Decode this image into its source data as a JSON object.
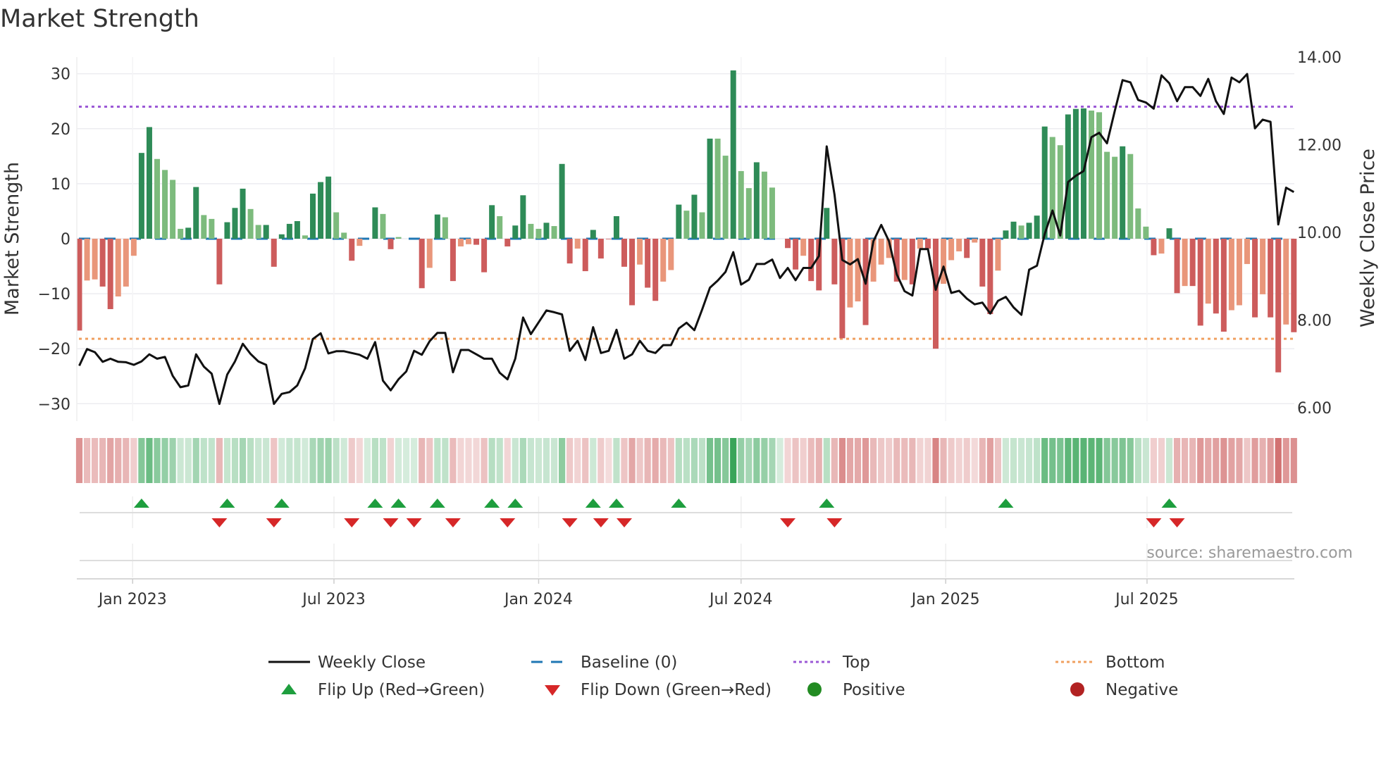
{
  "title": "Market Strength",
  "source": "source: sharemaestro.com",
  "colors": {
    "strong_green": "#2e8b57",
    "weak_green": "#7dbb7d",
    "strong_red": "#cd5c5c",
    "weak_red": "#e9967a",
    "line": "#111111",
    "baseline": "#1f77b4",
    "top": "#9b59d6",
    "bottom": "#f0a060",
    "flip_up": "#1e9e3e",
    "flip_down": "#d62728",
    "positive": "#228b22",
    "negative": "#b22222"
  },
  "chart_data": {
    "type": "bar",
    "title": "Market Strength",
    "ylabel": "Market Strength",
    "y2label": "Weekly Close Price",
    "ylim": [
      -33,
      33
    ],
    "y2lim": [
      5.4,
      14.6
    ],
    "yticks": [
      "30",
      "20",
      "10",
      "0",
      "−10",
      "−20",
      "−30"
    ],
    "ytick_values": [
      30,
      20,
      10,
      0,
      -10,
      -20,
      -30
    ],
    "y2ticks": [
      "14.00",
      "12.00",
      "10.00",
      "8.00",
      "6.00"
    ],
    "y2tick_values": [
      14,
      12,
      10,
      8,
      6
    ],
    "xticks": [
      {
        "label": "Jan 2023",
        "date": "2023-01-01"
      },
      {
        "label": "Jul 2023",
        "date": "2023-07-01"
      },
      {
        "label": "Jan 2024",
        "date": "2024-01-01"
      },
      {
        "label": "Jul 2024",
        "date": "2024-07-01"
      },
      {
        "label": "Jan 2025",
        "date": "2025-01-01"
      },
      {
        "label": "Jul 2025",
        "date": "2025-07-01"
      }
    ],
    "x_start": "2022-11-14",
    "x_step_days": 7,
    "top_level": 24,
    "bottom_level": -18.2,
    "baseline": 0,
    "strength": [
      -16.7,
      -7.6,
      -7.4,
      -8.7,
      -12.8,
      -10.5,
      -8.7,
      -3.1,
      15.6,
      20.3,
      14.5,
      12.5,
      10.7,
      1.8,
      2.0,
      9.4,
      4.3,
      3.6,
      -8.3,
      3.0,
      5.6,
      9.1,
      5.4,
      2.5,
      2.5,
      -5.1,
      0.8,
      2.7,
      3.2,
      0.6,
      8.2,
      10.3,
      11.3,
      4.8,
      1.1,
      -4.0,
      -1.3,
      0,
      5.7,
      4.5,
      -1.9,
      0.3,
      0,
      0,
      -9.0,
      -5.3,
      4.4,
      3.9,
      -7.7,
      -1.4,
      -1.0,
      -1.1,
      -6.1,
      6.1,
      4.1,
      -1.4,
      2.4,
      7.9,
      2.7,
      1.8,
      2.9,
      2.3,
      13.6,
      -4.5,
      -1.8,
      -5.9,
      1.6,
      -3.6,
      -0.1,
      4.1,
      -5.1,
      -12.1,
      -4.7,
      -8.9,
      -11.3,
      -7.8,
      -5.7,
      6.2,
      5.1,
      8.0,
      4.8,
      18.2,
      18.2,
      15.1,
      30.6,
      12.3,
      9.2,
      13.9,
      12.2,
      9.3,
      0,
      -1.7,
      -5.6,
      -3.1,
      -7.7,
      -9.4,
      5.6,
      -8.3,
      -18.1,
      -12.5,
      -11.4,
      -15.7,
      -7.8,
      -4.7,
      -3.5,
      -7.8,
      -7.5,
      -8.3,
      -1.8,
      -1.8,
      -20.0,
      -8.2,
      -3.9,
      -2.3,
      -3.5,
      -0.7,
      -8.7,
      -13.7,
      -5.8,
      1.5,
      3.1,
      2.4,
      2.9,
      4.2,
      20.4,
      18.5,
      17.0,
      22.6,
      23.6,
      23.7,
      23.3,
      23.0,
      15.8,
      14.9,
      16.8,
      15.4,
      5.5,
      2.2,
      -3.0,
      -2.7,
      1.9,
      -9.9,
      -8.6,
      -8.6,
      -15.8,
      -11.8,
      -13.6,
      -16.9,
      -13.0,
      -12.1,
      -4.6,
      -14.3,
      -10.1,
      -14.3,
      -24.3,
      -15.6,
      -17.0
    ],
    "shade": [
      "R",
      "o",
      "o",
      "R",
      "R",
      "o",
      "o",
      "o",
      "G",
      "G",
      "g",
      "g",
      "g",
      "g",
      "G",
      "G",
      "g",
      "g",
      "R",
      "G",
      "G",
      "G",
      "g",
      "g",
      "G",
      "R",
      "G",
      "G",
      "G",
      "g",
      "G",
      "G",
      "G",
      "g",
      "g",
      "R",
      "o",
      "o",
      "G",
      "g",
      "R",
      "g",
      "R",
      "R",
      "R",
      "o",
      "G",
      "g",
      "R",
      "o",
      "o",
      "R",
      "R",
      "G",
      "g",
      "R",
      "G",
      "G",
      "g",
      "g",
      "G",
      "g",
      "G",
      "R",
      "o",
      "R",
      "G",
      "R",
      "R",
      "G",
      "R",
      "R",
      "o",
      "R",
      "R",
      "o",
      "o",
      "G",
      "g",
      "G",
      "g",
      "G",
      "g",
      "g",
      "G",
      "g",
      "g",
      "G",
      "g",
      "g",
      "g",
      "R",
      "R",
      "o",
      "R",
      "R",
      "G",
      "R",
      "R",
      "o",
      "o",
      "R",
      "o",
      "o",
      "o",
      "R",
      "o",
      "R",
      "o",
      "R",
      "R",
      "o",
      "o",
      "o",
      "R",
      "o",
      "R",
      "R",
      "o",
      "G",
      "G",
      "g",
      "G",
      "G",
      "G",
      "g",
      "g",
      "G",
      "G",
      "G",
      "g",
      "g",
      "g",
      "g",
      "G",
      "g",
      "g",
      "g",
      "R",
      "o",
      "G",
      "R",
      "o",
      "R",
      "R",
      "o",
      "R",
      "R",
      "o",
      "o",
      "o",
      "R",
      "o",
      "R",
      "R",
      "o",
      "R"
    ],
    "weekly_close": [
      6.96,
      7.34,
      7.27,
      7.05,
      7.12,
      7.05,
      7.04,
      6.98,
      7.06,
      7.22,
      7.12,
      7.16,
      6.73,
      6.47,
      6.51,
      7.22,
      6.94,
      6.78,
      6.09,
      6.76,
      7.06,
      7.46,
      7.23,
      7.06,
      6.98,
      6.09,
      6.32,
      6.36,
      6.51,
      6.9,
      7.57,
      7.7,
      7.24,
      7.29,
      7.29,
      7.25,
      7.21,
      7.12,
      7.5,
      6.62,
      6.4,
      6.65,
      6.83,
      7.3,
      7.21,
      7.52,
      7.71,
      7.71,
      6.81,
      7.32,
      7.32,
      7.22,
      7.12,
      7.12,
      6.8,
      6.65,
      7.12,
      8.06,
      7.68,
      7.95,
      8.22,
      8.18,
      8.13,
      7.3,
      7.53,
      7.09,
      7.84,
      7.25,
      7.3,
      7.78,
      7.12,
      7.22,
      7.53,
      7.3,
      7.25,
      7.43,
      7.43,
      7.81,
      7.94,
      7.77,
      8.24,
      8.74,
      8.9,
      9.1,
      9.55,
      8.81,
      8.92,
      9.28,
      9.28,
      9.38,
      8.96,
      9.19,
      8.91,
      9.19,
      9.19,
      9.46,
      11.96,
      10.86,
      9.37,
      9.27,
      9.39,
      8.83,
      9.8,
      10.17,
      9.8,
      9.04,
      8.66,
      8.56,
      9.62,
      9.62,
      8.69,
      9.22,
      8.62,
      8.67,
      8.49,
      8.36,
      8.4,
      8.15,
      8.44,
      8.53,
      8.29,
      8.12,
      9.15,
      9.24,
      9.96,
      10.5,
      9.93,
      11.15,
      11.29,
      11.4,
      12.17,
      12.27,
      12.03,
      12.77,
      13.47,
      13.42,
      13.02,
      12.96,
      12.82,
      13.58,
      13.4,
      12.99,
      13.31,
      13.31,
      13.11,
      13.5,
      12.99,
      12.7,
      13.53,
      13.42,
      13.61,
      12.37,
      12.57,
      12.52,
      10.18,
      11.02,
      10.92
    ],
    "flip_up": [
      "2023-01-09",
      "2023-03-27",
      "2023-05-15",
      "2023-08-07",
      "2023-08-28",
      "2023-10-02",
      "2023-11-20",
      "2023-12-11",
      "2024-02-19",
      "2024-03-11",
      "2024-05-06",
      "2024-09-16",
      "2025-02-24",
      "2025-07-21"
    ],
    "flip_down": [
      "2023-03-20",
      "2023-05-08",
      "2023-07-17",
      "2023-08-21",
      "2023-09-11",
      "2023-10-16",
      "2023-12-04",
      "2024-01-29",
      "2024-02-26",
      "2024-03-18",
      "2024-08-12",
      "2024-09-23",
      "2025-07-07",
      "2025-07-28"
    ],
    "legend": {
      "placement": "bottom",
      "items": [
        "Weekly Close",
        "Baseline (0)",
        "Top",
        "Bottom",
        "Flip Up (Red→Green)",
        "Flip Down (Green→Red)",
        "Positive",
        "Negative"
      ]
    }
  }
}
